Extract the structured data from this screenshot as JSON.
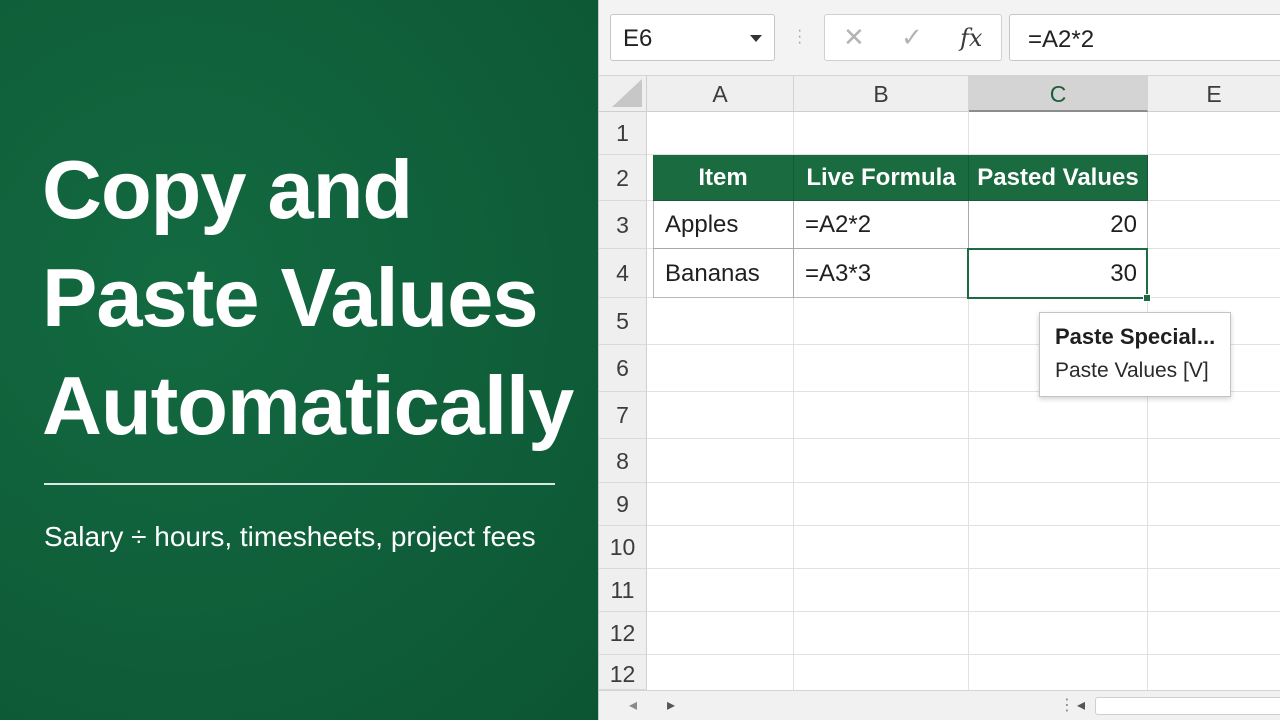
{
  "hero": {
    "title_lines": [
      "Copy and",
      "Paste Values",
      "Automatically"
    ],
    "subtitle": "Salary ÷ hours, timesheets, project fees"
  },
  "formula_bar": {
    "name_box": "E6",
    "cancel_icon": "✕",
    "confirm_icon": "✓",
    "fx_label": "fx",
    "formula": "=A2*2"
  },
  "columns": [
    "A",
    "B",
    "C",
    "E"
  ],
  "rows": [
    "1",
    "2",
    "3",
    "4",
    "5",
    "6",
    "7",
    "8",
    "9",
    "10",
    "11",
    "12",
    "12"
  ],
  "table": {
    "headers": [
      "Item",
      "Live Formula",
      "Pasted Values"
    ],
    "rows": [
      {
        "item": "Apples",
        "formula": "=A2*2",
        "value": "20"
      },
      {
        "item": "Bananas",
        "formula": "=A3*3",
        "value": "30"
      }
    ]
  },
  "context_menu": {
    "item_1": "Paste Special...",
    "item_2": "Paste Values [V]"
  },
  "colors": {
    "brand_green": "#0f5e39",
    "header_green": "#1a6b3f"
  }
}
